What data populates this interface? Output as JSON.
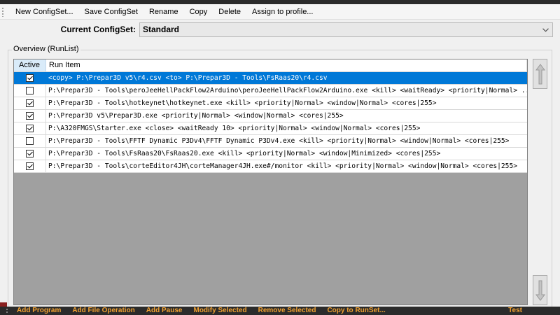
{
  "menubar": {
    "items": [
      "New ConfigSet...",
      "Save ConfigSet",
      "Rename",
      "Copy",
      "Delete",
      "Assign to profile..."
    ]
  },
  "configset": {
    "label": "Current ConfigSet:",
    "value": "Standard"
  },
  "overview": {
    "title": "Overview (RunList)",
    "columns": {
      "active": "Active",
      "item": "Run Item"
    },
    "rows": [
      {
        "active": true,
        "selected": true,
        "text": "<copy> P:\\Prepar3D v5\\r4.csv <to> P:\\Prepar3D - Tools\\FsRaas20\\r4.csv"
      },
      {
        "active": false,
        "selected": false,
        "text": "P:\\Prepar3D - Tools\\peroJeeHellPackFlow2Arduino\\peroJeeHellPackFlow2Arduino.exe <kill> <waitReady> <priority|Normal> ..."
      },
      {
        "active": true,
        "selected": false,
        "text": "P:\\Prepar3D - Tools\\hotkeynet\\hotkeynet.exe <kill> <priority|Normal> <window|Normal> <cores|255>"
      },
      {
        "active": true,
        "selected": false,
        "text": "P:\\Prepar3D v5\\Prepar3D.exe <priority|Normal> <window|Normal> <cores|255>"
      },
      {
        "active": true,
        "selected": false,
        "text": "P:\\A320FMGS\\Starter.exe <close> <waitReady 10> <priority|Normal> <window|Normal> <cores|255>"
      },
      {
        "active": false,
        "selected": false,
        "text": "P:\\Prepar3D - Tools\\FFTF Dynamic P3Dv4\\FFTF Dynamic P3Dv4.exe <kill> <priority|Normal> <window|Normal> <cores|255>"
      },
      {
        "active": true,
        "selected": false,
        "text": "P:\\Prepar3D - Tools\\FsRaas20\\FsRaas20.exe <kill> <priority|Normal> <window|Minimized> <cores|255>"
      },
      {
        "active": true,
        "selected": false,
        "text": "P:\\Prepar3D - Tools\\corteEditor4JH\\corteManager4JH.exe#/monitor <kill> <priority|Normal> <window|Normal> <cores|255>"
      }
    ]
  },
  "bottombar": {
    "items": [
      "Add Program",
      "Add File Operation",
      "Add Pause",
      "Modify Selected",
      "Remove Selected",
      "Copy to RunSet..."
    ],
    "test_label": "Test"
  },
  "icons": {
    "move_up": "arrow-up-icon",
    "move_down": "arrow-down-icon",
    "dropdown": "chevron-down-icon"
  },
  "colors": {
    "selection": "#0078d7",
    "bottom_bar_text": "#f0a030",
    "grid_empty": "#a0a0a0"
  }
}
